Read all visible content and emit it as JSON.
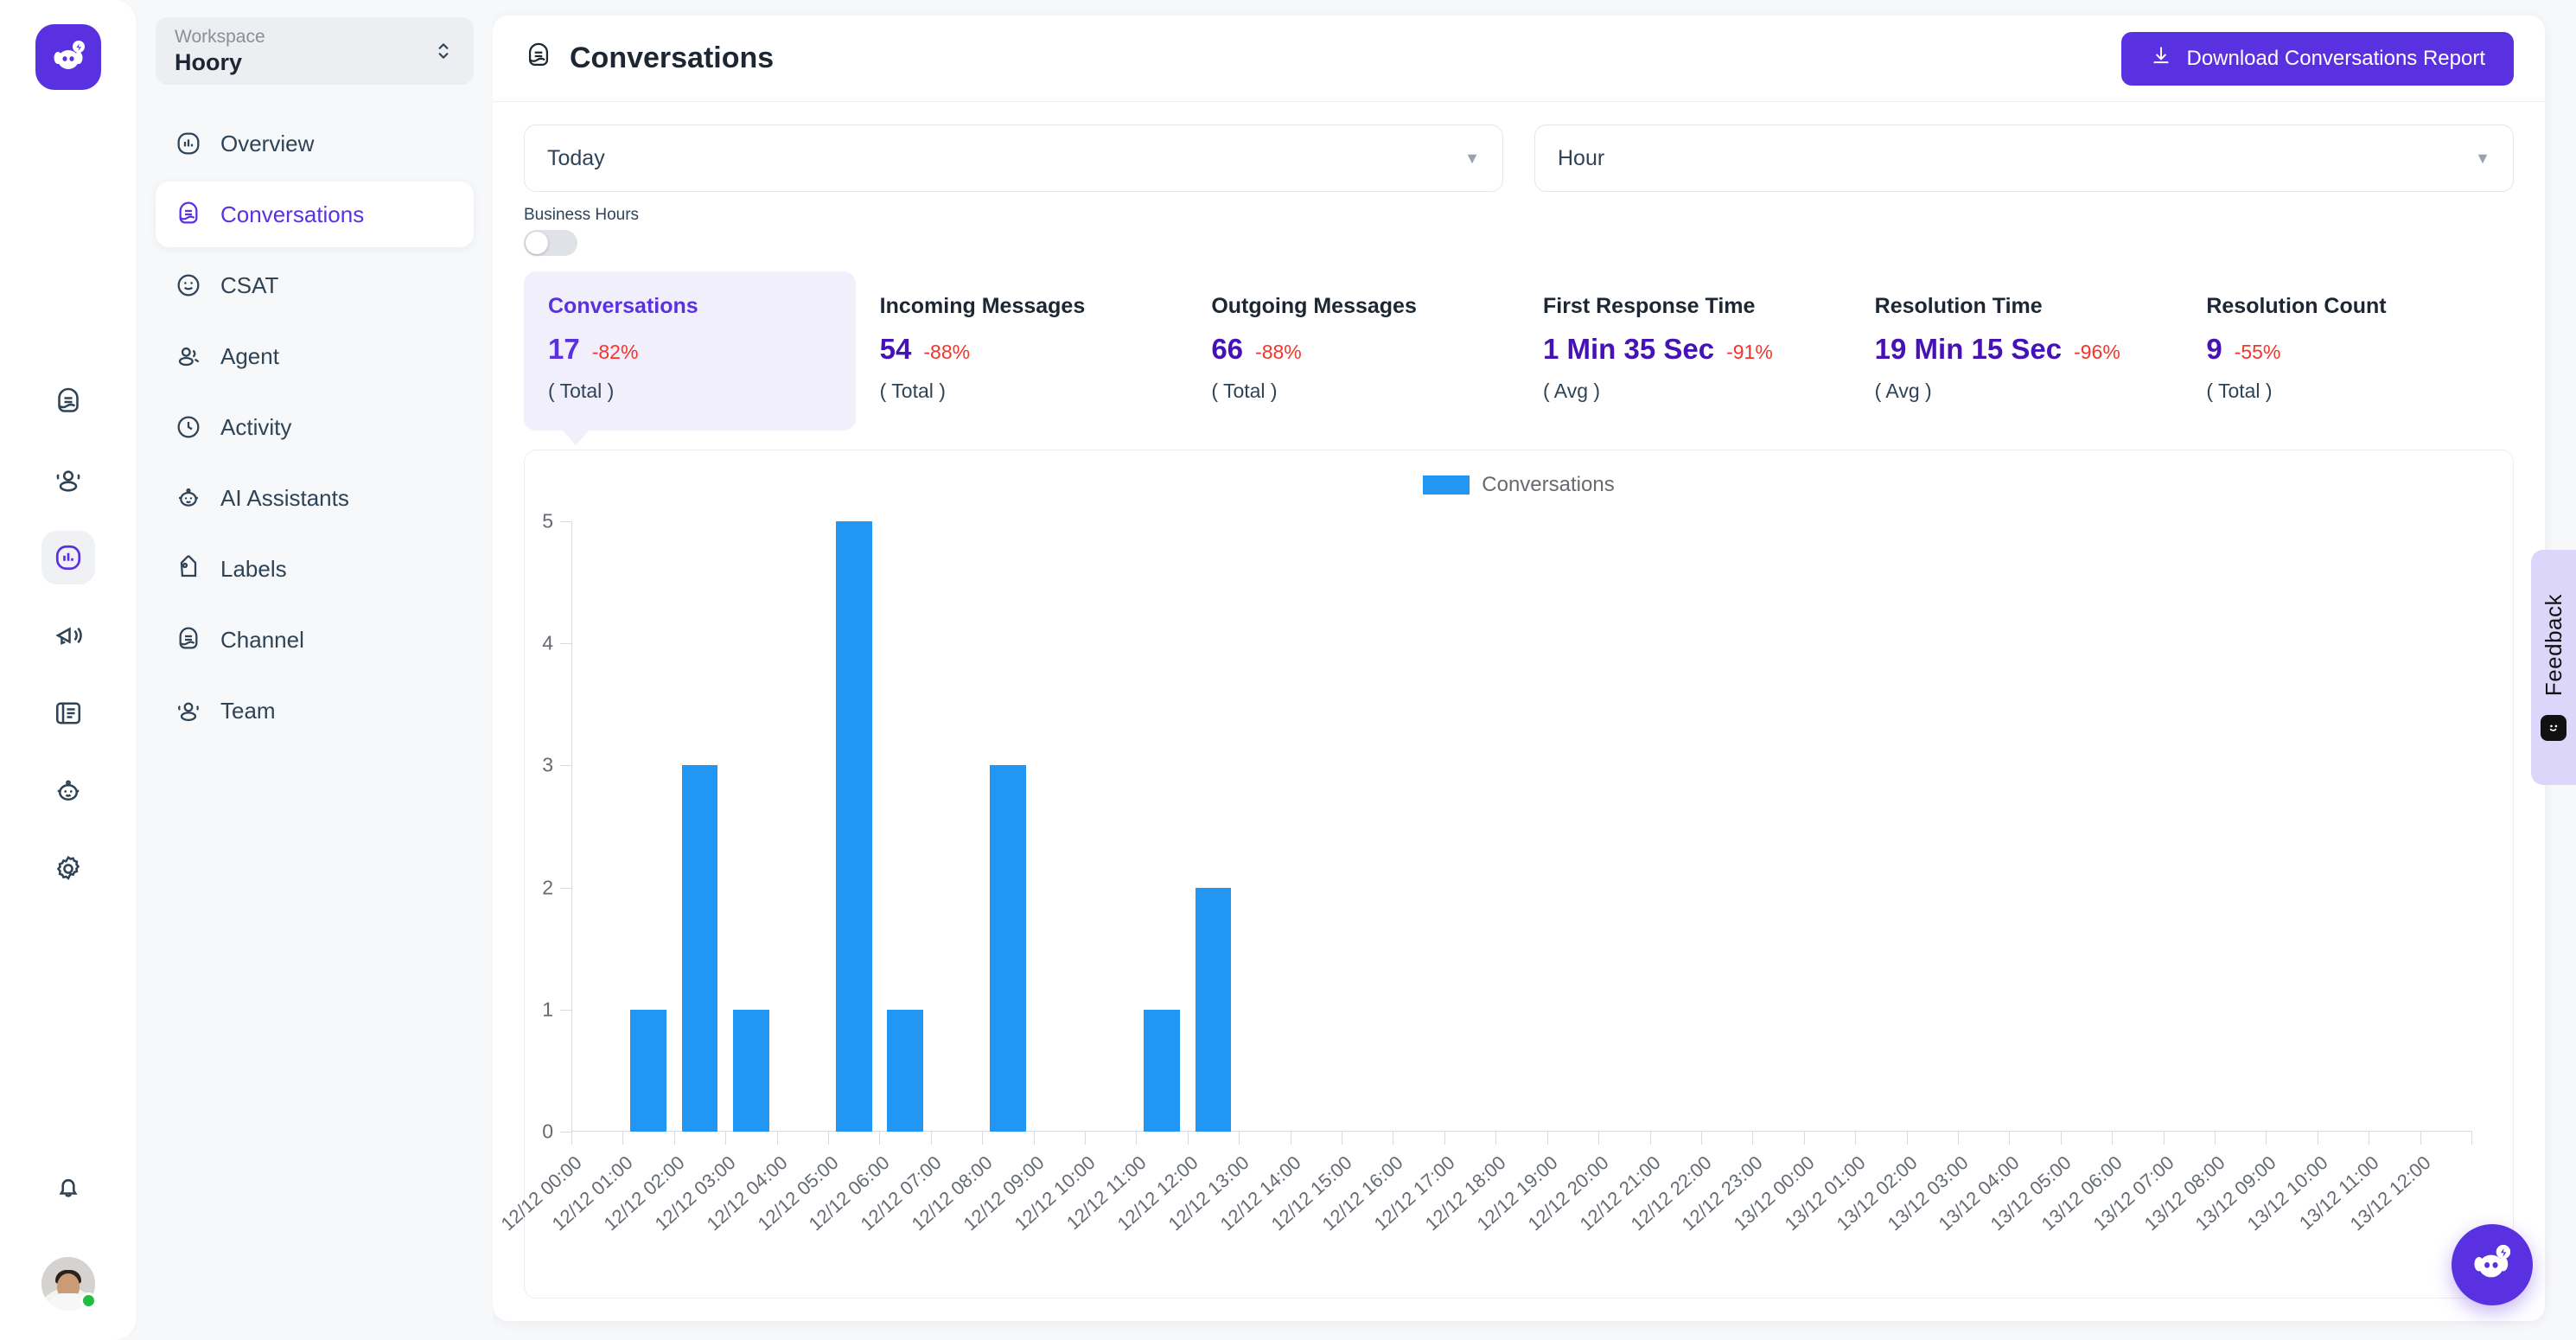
{
  "rail": {
    "logo_icon": "hoory-logo-icon",
    "icons": [
      {
        "name": "conversations-icon",
        "active": false
      },
      {
        "name": "contacts-icon",
        "active": false
      },
      {
        "name": "reports-icon",
        "active": true
      },
      {
        "name": "campaigns-icon",
        "active": false
      },
      {
        "name": "knowledge-base-icon",
        "active": false
      },
      {
        "name": "ai-assistant-icon",
        "active": false
      },
      {
        "name": "settings-icon",
        "active": false
      }
    ],
    "notifications_icon": "bell-icon",
    "avatar_name": "user-avatar",
    "status": "online"
  },
  "workspace": {
    "label": "Workspace",
    "name": "Hoory"
  },
  "sidebar": {
    "items": [
      {
        "label": "Overview",
        "icon": "bar-chart-icon",
        "active": false
      },
      {
        "label": "Conversations",
        "icon": "conversation-icon",
        "active": true
      },
      {
        "label": "CSAT",
        "icon": "smiley-icon",
        "active": false
      },
      {
        "label": "Agent",
        "icon": "user-group-icon",
        "active": false
      },
      {
        "label": "Activity",
        "icon": "clock-icon",
        "active": false
      },
      {
        "label": "AI Assistants",
        "icon": "robot-icon",
        "active": false
      },
      {
        "label": "Labels",
        "icon": "tag-icon",
        "active": false
      },
      {
        "label": "Channel",
        "icon": "conversation-icon",
        "active": false
      },
      {
        "label": "Team",
        "icon": "team-icon",
        "active": false
      }
    ]
  },
  "header": {
    "title": "Conversations",
    "title_icon": "conversation-icon",
    "download_label": "Download Conversations Report",
    "download_icon": "download-icon",
    "accent_color": "#5a31e1"
  },
  "filters": {
    "range": {
      "value": "Today",
      "caret_icon": "chevron-down-icon"
    },
    "grouping": {
      "value": "Hour",
      "caret_icon": "chevron-down-icon"
    },
    "business_hours_label": "Business Hours",
    "business_hours_on": false
  },
  "metrics": [
    {
      "title": "Conversations",
      "value": "17",
      "delta": "-82%",
      "sub": "( Total )",
      "selected": true
    },
    {
      "title": "Incoming Messages",
      "value": "54",
      "delta": "-88%",
      "sub": "( Total )",
      "selected": false
    },
    {
      "title": "Outgoing Messages",
      "value": "66",
      "delta": "-88%",
      "sub": "( Total )",
      "selected": false
    },
    {
      "title": "First Response Time",
      "value": "1 Min 35 Sec",
      "delta": "-91%",
      "sub": "( Avg )",
      "selected": false
    },
    {
      "title": "Resolution Time",
      "value": "19 Min 15 Sec",
      "delta": "-96%",
      "sub": "( Avg )",
      "selected": false
    },
    {
      "title": "Resolution Count",
      "value": "9",
      "delta": "-55%",
      "sub": "( Total )",
      "selected": false
    }
  ],
  "chart_data": {
    "type": "bar",
    "title": "",
    "xlabel": "",
    "ylabel": "",
    "ylim": [
      0,
      5
    ],
    "yticks": [
      0,
      1,
      2,
      3,
      4,
      5
    ],
    "grid": false,
    "legend_position": "top-center",
    "series": [
      {
        "name": "Conversations",
        "color": "#2196f3",
        "values": [
          0,
          1,
          3,
          1,
          0,
          5,
          1,
          0,
          3,
          0,
          0,
          1,
          2,
          0,
          0,
          0,
          0,
          0,
          0,
          0,
          0,
          0,
          0,
          0,
          0,
          0,
          0,
          0,
          0,
          0,
          0,
          0,
          0,
          0,
          0,
          0,
          0
        ]
      }
    ],
    "categories": [
      "12/12 00:00",
      "12/12 01:00",
      "12/12 02:00",
      "12/12 03:00",
      "12/12 04:00",
      "12/12 05:00",
      "12/12 06:00",
      "12/12 07:00",
      "12/12 08:00",
      "12/12 09:00",
      "12/12 10:00",
      "12/12 11:00",
      "12/12 12:00",
      "12/12 13:00",
      "12/12 14:00",
      "12/12 15:00",
      "12/12 16:00",
      "12/12 17:00",
      "12/12 18:00",
      "12/12 19:00",
      "12/12 20:00",
      "12/12 21:00",
      "12/12 22:00",
      "12/12 23:00",
      "13/12 00:00",
      "13/12 01:00",
      "13/12 02:00",
      "13/12 03:00",
      "13/12 04:00",
      "13/12 05:00",
      "13/12 06:00",
      "13/12 07:00",
      "13/12 08:00",
      "13/12 09:00",
      "13/12 10:00",
      "13/12 11:00",
      "13/12 12:00"
    ]
  },
  "feedback": {
    "label": "Feedback",
    "icon": "smiley-icon"
  },
  "chat": {
    "icon": "hoory-bot-icon"
  }
}
